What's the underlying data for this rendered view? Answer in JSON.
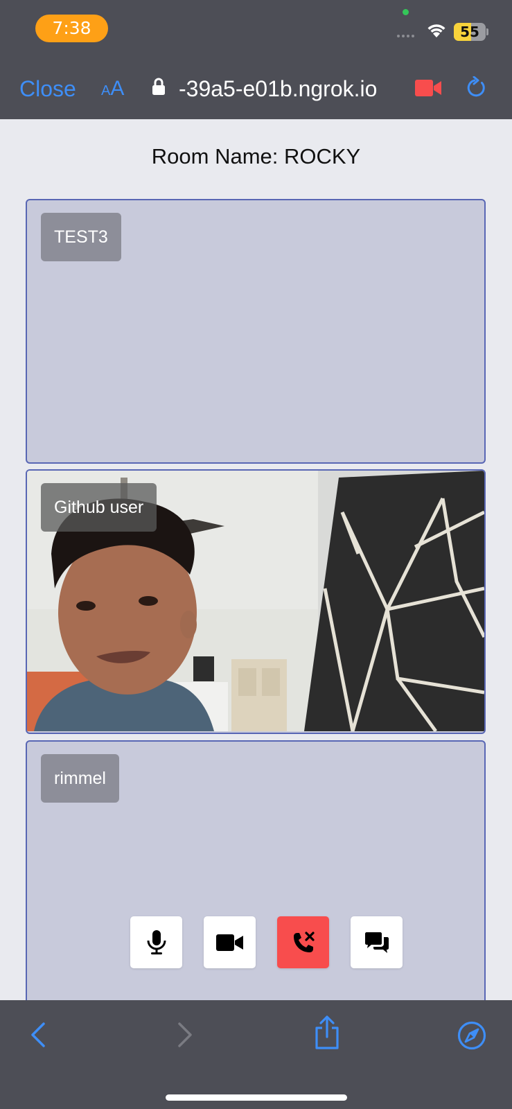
{
  "status_bar": {
    "time": "7:38",
    "battery_level": "55",
    "battery_fraction": 0.55,
    "accent": "#fea016"
  },
  "browser": {
    "close_label": "Close",
    "aa_small": "A",
    "aa_big": "A",
    "url": "-39a5-e01b.ngrok.io",
    "link_color": "#3e8ef7",
    "camera_indicator_color": "#f84d4d"
  },
  "room": {
    "title": "Room Name: ROCKY"
  },
  "participants": [
    {
      "name": "TEST3",
      "video": "off"
    },
    {
      "name": "Github user",
      "video": "on"
    },
    {
      "name": "rimmel",
      "video": "off"
    }
  ],
  "controls": [
    {
      "icon": "microphone-icon"
    },
    {
      "icon": "video-camera-icon"
    },
    {
      "icon": "end-call-icon",
      "color": "#f84d4d"
    },
    {
      "icon": "chat-icon"
    }
  ],
  "bottom_toolbar": {
    "icons": [
      "back-arrow-icon",
      "forward-arrow-icon",
      "share-icon",
      "compass-icon"
    ]
  }
}
